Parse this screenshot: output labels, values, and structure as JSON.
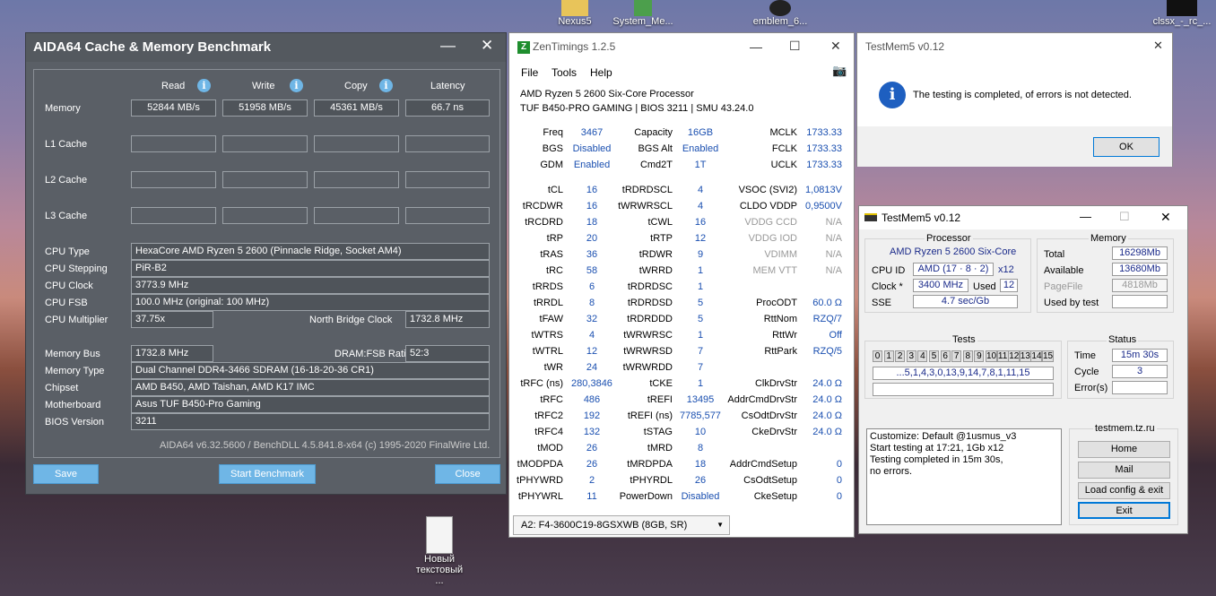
{
  "desktop": {
    "icons": [
      "Nexus5",
      "System_Me...",
      "emblem_6...",
      "clssx_-_rc_...",
      "Новый текстовый ..."
    ]
  },
  "aida": {
    "title": "AIDA64 Cache & Memory Benchmark",
    "cols": [
      "Read",
      "Write",
      "Copy",
      "Latency"
    ],
    "rows": [
      {
        "label": "Memory",
        "vals": [
          "52844 MB/s",
          "51958 MB/s",
          "45361 MB/s",
          "66.7 ns"
        ]
      },
      {
        "label": "L1 Cache"
      },
      {
        "label": "L2 Cache"
      },
      {
        "label": "L3 Cache"
      }
    ],
    "cpu_type_l": "CPU Type",
    "cpu_type": "HexaCore AMD Ryzen 5 2600  (Pinnacle Ridge, Socket AM4)",
    "cpu_step_l": "CPU Stepping",
    "cpu_step": "PiR-B2",
    "cpu_clock_l": "CPU Clock",
    "cpu_clock": "3773.9 MHz",
    "cpu_fsb_l": "CPU FSB",
    "cpu_fsb": "100.0 MHz  (original: 100 MHz)",
    "cpu_mult_l": "CPU Multiplier",
    "cpu_mult": "37.75x",
    "nb_l": "North Bridge Clock",
    "nb": "1732.8 MHz",
    "mbus_l": "Memory Bus",
    "mbus": "1732.8 MHz",
    "ratio_l": "DRAM:FSB Ratio",
    "ratio": "52:3",
    "mtype_l": "Memory Type",
    "mtype": "Dual Channel DDR4-3466 SDRAM  (16-18-20-36 CR1)",
    "chip_l": "Chipset",
    "chip": "AMD B450, AMD Taishan, AMD K17 IMC",
    "mb_l": "Motherboard",
    "mb": "Asus TUF B450-Pro Gaming",
    "bios_l": "BIOS Version",
    "bios": "3211",
    "footer": "AIDA64 v6.32.5600 / BenchDLL 4.5.841.8-x64  (c) 1995-2020 FinalWire Ltd.",
    "save": "Save",
    "start": "Start Benchmark",
    "close": "Close"
  },
  "zen": {
    "title": "ZenTimings 1.2.5",
    "menu": [
      "File",
      "Tools",
      "Help"
    ],
    "cpu": "AMD Ryzen 5 2600 Six-Core Processor",
    "board": "TUF B450-PRO GAMING | BIOS 3211 | SMU 43.24.0",
    "top": [
      [
        "Freq",
        "3467",
        "Capacity",
        "16GB",
        "MCLK",
        "1733.33"
      ],
      [
        "BGS",
        "Disabled",
        "BGS Alt",
        "Enabled",
        "FCLK",
        "1733.33"
      ],
      [
        "GDM",
        "Enabled",
        "Cmd2T",
        "1T",
        "UCLK",
        "1733.33"
      ]
    ],
    "timings": [
      [
        "tCL",
        "16",
        "tRDRDSCL",
        "4",
        "VSOC (SVI2)",
        "1,0813V"
      ],
      [
        "tRCDWR",
        "16",
        "tWRWRSCL",
        "4",
        "CLDO VDDP",
        "0,9500V"
      ],
      [
        "tRCDRD",
        "18",
        "tCWL",
        "16",
        "VDDG CCD",
        "N/A"
      ],
      [
        "tRP",
        "20",
        "tRTP",
        "12",
        "VDDG IOD",
        "N/A"
      ],
      [
        "tRAS",
        "36",
        "tRDWR",
        "9",
        "VDIMM",
        "N/A"
      ],
      [
        "tRC",
        "58",
        "tWRRD",
        "1",
        "MEM VTT",
        "N/A"
      ],
      [
        "tRRDS",
        "6",
        "tRDRDSC",
        "1",
        "",
        ""
      ],
      [
        "tRRDL",
        "8",
        "tRDRDSD",
        "5",
        "ProcODT",
        "60.0 Ω"
      ],
      [
        "tFAW",
        "32",
        "tRDRDDD",
        "5",
        "RttNom",
        "RZQ/7"
      ],
      [
        "tWTRS",
        "4",
        "tWRWRSC",
        "1",
        "RttWr",
        "Off"
      ],
      [
        "tWTRL",
        "12",
        "tWRWRSD",
        "7",
        "RttPark",
        "RZQ/5"
      ],
      [
        "tWR",
        "24",
        "tWRWRDD",
        "7",
        "",
        ""
      ],
      [
        "tRFC (ns)",
        "280,3846",
        "tCKE",
        "1",
        "ClkDrvStr",
        "24.0 Ω"
      ],
      [
        "tRFC",
        "486",
        "tREFI",
        "13495",
        "AddrCmdDrvStr",
        "24.0 Ω"
      ],
      [
        "tRFC2",
        "192",
        "tREFI (ns)",
        "7785,577",
        "CsOdtDrvStr",
        "24.0 Ω"
      ],
      [
        "tRFC4",
        "132",
        "tSTAG",
        "10",
        "CkeDrvStr",
        "24.0 Ω"
      ],
      [
        "tMOD",
        "26",
        "tMRD",
        "8",
        "",
        ""
      ],
      [
        "tMODPDA",
        "26",
        "tMRDPDA",
        "18",
        "AddrCmdSetup",
        "0"
      ],
      [
        "tPHYWRD",
        "2",
        "tPHYRDL",
        "26",
        "CsOdtSetup",
        "0"
      ],
      [
        "tPHYWRL",
        "11",
        "PowerDown",
        "Disabled",
        "CkeSetup",
        "0"
      ]
    ],
    "dimm": "A2: F4-3600C19-8GSXWB (8GB, SR)"
  },
  "tm1": {
    "title": "TestMem5 v0.12",
    "msg": "The testing is completed, of errors is not detected.",
    "ok": "OK"
  },
  "tm2": {
    "title": "TestMem5 v0.12",
    "proc_h": "Processor",
    "proc": "AMD Ryzen 5 2600 Six-Core",
    "cpuid_l": "CPU ID",
    "cpuid": "AMD  (17 · 8 · 2)",
    "x": "x12",
    "clock_l": "Clock *",
    "clock": "3400 MHz",
    "used_l": "Used",
    "used": "12",
    "sse_l": "SSE",
    "sse": "4.7 sec/Gb",
    "mem_h": "Memory",
    "total_l": "Total",
    "total": "16298Mb",
    "avail_l": "Available",
    "avail": "13680Mb",
    "pf_l": "PageFile",
    "pf": "4818Mb",
    "ubt_l": "Used by test",
    "ubt": "",
    "tests_h": "Tests",
    "tests": [
      "0",
      "1",
      "2",
      "3",
      "4",
      "5",
      "6",
      "7",
      "8",
      "9",
      "10",
      "11",
      "12",
      "13",
      "14",
      "15"
    ],
    "seq": "...5,1,4,3,0,13,9,14,7,8,1,11,15",
    "status_h": "Status",
    "time_l": "Time",
    "time": "15m 30s",
    "cycle_l": "Cycle",
    "cycle": "3",
    "err_l": "Error(s)",
    "err": "",
    "log": [
      "Customize: Default @1usmus_v3",
      "Start testing at 17:21, 1Gb x12",
      "Testing completed in 15m 30s,",
      "no errors."
    ],
    "site": "testmem.tz.ru",
    "home": "Home",
    "mail": "Mail",
    "load": "Load config & exit",
    "exit": "Exit"
  }
}
